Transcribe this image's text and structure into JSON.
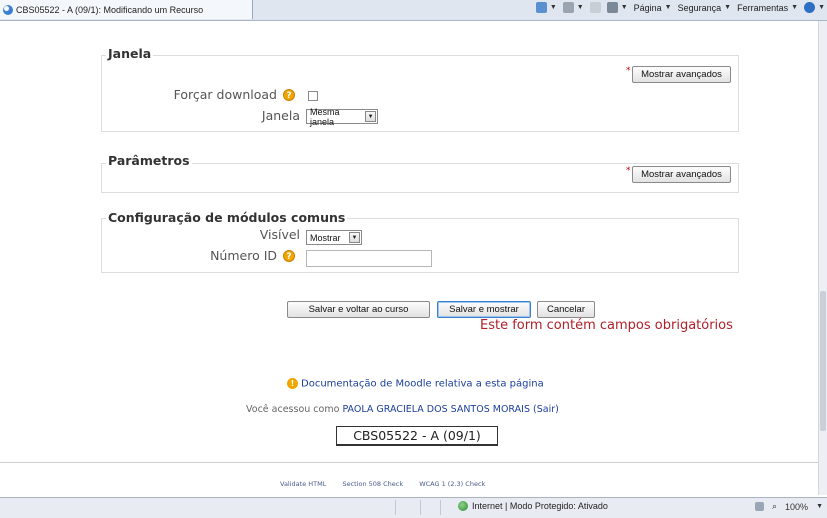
{
  "browser": {
    "tab_title": "CBS05522 - A (09/1): Modificando um Recurso",
    "cmd_pagina": "Página",
    "cmd_seguranca": "Segurança",
    "cmd_ferramentas": "Ferramentas",
    "status_zone": "Internet | Modo Protegido: Ativado",
    "zoom": "100%"
  },
  "janela": {
    "legend": "Janela",
    "advanced_button": "Mostrar avançados",
    "forcar_download_label": "Forçar download",
    "janela_label": "Janela",
    "janela_value": "Mesma janela"
  },
  "parametros": {
    "legend": "Parâmetros",
    "advanced_button": "Mostrar avançados"
  },
  "modulos": {
    "legend": "Configuração de módulos comuns",
    "visivel_label": "Visível",
    "visivel_value": "Mostrar",
    "numero_id_label": "Número ID",
    "numero_id_value": ""
  },
  "actions": {
    "save_return": "Salvar e voltar ao curso",
    "save_show": "Salvar e mostrar",
    "cancel": "Cancelar",
    "required_msg": "Este form contém campos obrigatórios"
  },
  "footer": {
    "docs_link": "Documentação de Moodle relativa a esta página",
    "logged_prefix": "Você acessou como",
    "user_name": "PAOLA GRACIELA DOS SANTOS MORAIS",
    "logout": "(Sair)",
    "course_code": "CBS05522 - A (09/1)",
    "validate_html": "Validate HTML",
    "section_508": "Section 508 Check",
    "wcag": "WCAG 1 (2.3) Check"
  },
  "colors": {
    "required_red": "#b0202a",
    "link_blue": "#1c3f9c"
  }
}
